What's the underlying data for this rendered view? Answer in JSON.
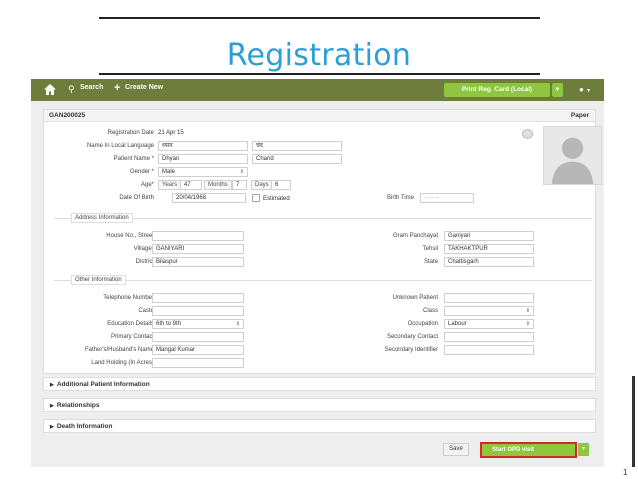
{
  "slide": {
    "title": "Registration",
    "page_number": "1"
  },
  "colors": {
    "title": "#2b9fd6",
    "nav_bar": "#6e7d3b",
    "primary_button": "#8ec63f",
    "highlight_border": "#d9262e"
  },
  "nav": {
    "home_icon": "home-icon",
    "search_label": "Search",
    "create_new_label": "Create New",
    "print_button_label": "Print Reg. Card (Local)",
    "user_icon": "user-icon"
  },
  "header": {
    "registration_id": "GAN200025",
    "paper_label": "Paper"
  },
  "form": {
    "registration_date": {
      "label": "Registration Date",
      "value": "21 Apr 15"
    },
    "local_name": {
      "label": "Name In Local Language",
      "first": "ध्यान",
      "last": "चंद"
    },
    "patient_name": {
      "label": "Patient Name *",
      "first": "Dhyan",
      "last": "Chand"
    },
    "gender": {
      "label": "Gender *",
      "value": "Male"
    },
    "age": {
      "label": "Age*",
      "years_label": "Years",
      "years": "47",
      "months_label": "Months",
      "months": "7",
      "days_label": "Days",
      "days": "6"
    },
    "dob": {
      "label": "Date Of Birth",
      "value": "20/04/1968",
      "estimated_label": "Estimated"
    },
    "birth_time": {
      "label": "Birth Time",
      "placeholder": "--:-- --"
    }
  },
  "address": {
    "section_title": "Address Information",
    "house": {
      "label": "House No., Street",
      "value": ""
    },
    "village": {
      "label": "Village*",
      "value": "GANIYARI"
    },
    "district": {
      "label": "District",
      "value": "Bilaspur"
    },
    "gram_panchayat": {
      "label": "Gram Panchayat",
      "value": "Ganiyari"
    },
    "tehsil": {
      "label": "Tehsil",
      "value": "TAKHAKTPUR"
    },
    "state": {
      "label": "State",
      "value": "Chattisgarh"
    }
  },
  "other": {
    "section_title": "Other Information",
    "telephone": {
      "label": "Telephone Number",
      "value": ""
    },
    "caste": {
      "label": "Caste",
      "value": ""
    },
    "education": {
      "label": "Education Details",
      "value": "6th to 9th"
    },
    "primary_contact": {
      "label": "Primary Contact",
      "value": ""
    },
    "guardian": {
      "label": "Father's/Husband's Name",
      "value": "Mangal Kumar"
    },
    "land": {
      "label": "Land Holding (In Acres)",
      "value": ""
    },
    "unknown_patient": {
      "label": "Unknown Patient",
      "value": ""
    },
    "class": {
      "label": "Class",
      "value": ""
    },
    "occupation": {
      "label": "Occupation",
      "value": "Labour"
    },
    "secondary_contact": {
      "label": "Secondary Contact",
      "value": ""
    },
    "secondary_identifier": {
      "label": "Secondary Identifier",
      "value": ""
    }
  },
  "sections": {
    "additional": "Additional Patient Information",
    "relationships": "Relationships",
    "death": "Death Information"
  },
  "actions": {
    "save_label": "Save",
    "opd_label": "Start OPD visit"
  }
}
